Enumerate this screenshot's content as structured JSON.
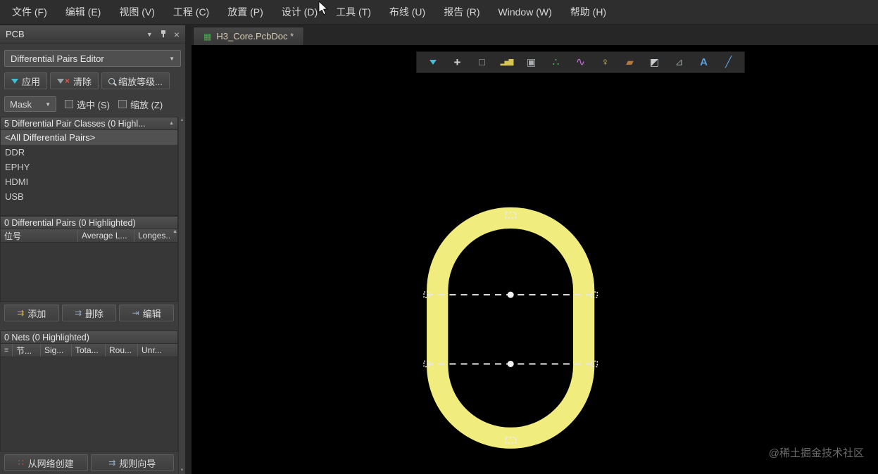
{
  "menubar": {
    "items": [
      "文件 (F)",
      "编辑 (E)",
      "视图 (V)",
      "工程 (C)",
      "放置 (P)",
      "设计 (D)",
      "工具 (T)",
      "布线 (U)",
      "报告 (R)",
      "Window (W)",
      "帮助 (H)"
    ]
  },
  "panel": {
    "title": "PCB",
    "editor_mode": "Differential Pairs Editor",
    "apply_label": "应用",
    "clear_label": "清除",
    "zoom_level_label": "缩放等级...",
    "mask_value": "Mask",
    "select_label": "选中 (S)",
    "zoom_label": "缩放 (Z)",
    "classes_header": "5 Differential Pair Classes (0 Highl...",
    "classes": [
      "<All Differential Pairs>",
      "DDR",
      "EPHY",
      "HDMI",
      "USB"
    ],
    "pairs_header": "0 Differential Pairs (0 Highlighted)",
    "pairs_columns": [
      "位号",
      "Average L...",
      "Longes..."
    ],
    "add_label": "添加",
    "delete_label": "删除",
    "edit_label": "编辑",
    "nets_header": "0 Nets (0 Highlighted)",
    "nets_columns": [
      "节...",
      "Sig...",
      "Tota...",
      "Rou...",
      "Unr..."
    ],
    "create_from_net_label": "从网络创建",
    "rule_wizard_label": "规则向导"
  },
  "tab": {
    "label": "H3_Core.PcbDoc *"
  },
  "toolbar": {
    "icons": [
      {
        "name": "filter-icon",
        "glyph": ""
      },
      {
        "name": "crosshair-icon",
        "glyph": "+"
      },
      {
        "name": "select-area-icon",
        "glyph": "□"
      },
      {
        "name": "histogram-icon",
        "glyph": "▂▅▇"
      },
      {
        "name": "component-icon",
        "glyph": "▣"
      },
      {
        "name": "interactive-route-icon",
        "glyph": "∴"
      },
      {
        "name": "differential-route-icon",
        "glyph": "∿"
      },
      {
        "name": "via-icon",
        "glyph": "♀"
      },
      {
        "name": "polygon-pour-icon",
        "glyph": "▰"
      },
      {
        "name": "region-icon",
        "glyph": "◩"
      },
      {
        "name": "measure-icon",
        "glyph": "⊿"
      },
      {
        "name": "text-icon",
        "glyph": "A"
      },
      {
        "name": "line-icon",
        "glyph": "╱"
      }
    ]
  },
  "icons": {
    "chevron_down": "▼",
    "close": "×",
    "sort_up": "▲",
    "clear_x": "×",
    "doc": "▦",
    "add": "⇉",
    "delete": "⇉",
    "edit": "⇥",
    "create": "∷",
    "wizard": "⇉",
    "nets_col": "≡",
    "scroll_up": "▲",
    "scroll_down": "▼"
  },
  "canvas": {
    "shape_color": "#f0ec7e",
    "background": "#000000"
  },
  "watermark": "@稀土掘金技术社区"
}
